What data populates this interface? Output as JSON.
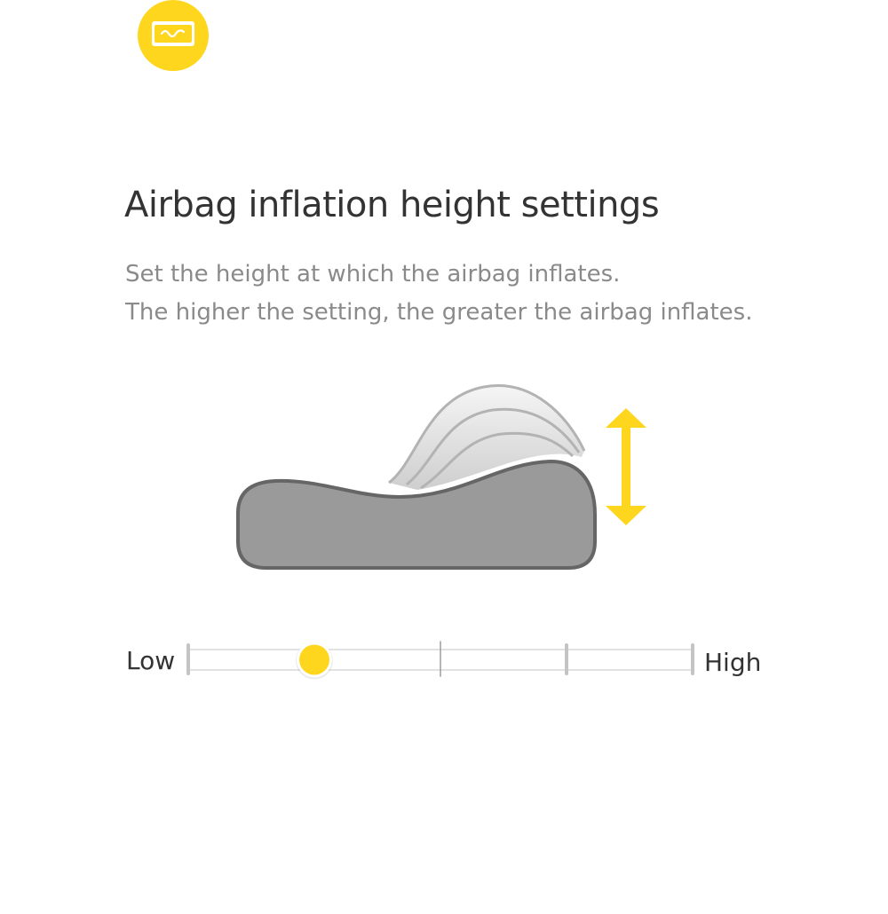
{
  "header": {
    "icon": "pillow-wave-icon",
    "accent_color": "#FFD61E"
  },
  "setting": {
    "title": "Airbag inflation height settings",
    "description_lines": [
      "Set the height at which the airbag inflates.",
      "The higher the setting, the greater the airbag inflates."
    ]
  },
  "illustration": {
    "pillow_icon": "pillow-icon",
    "airbag_icon": "airbag-layers-icon",
    "height_arrow_icon": "vertical-double-arrow-icon"
  },
  "slider": {
    "low_label": "Low",
    "high_label": "High",
    "steps": 5,
    "selected_step": 2,
    "selected_fraction": 0.25
  }
}
